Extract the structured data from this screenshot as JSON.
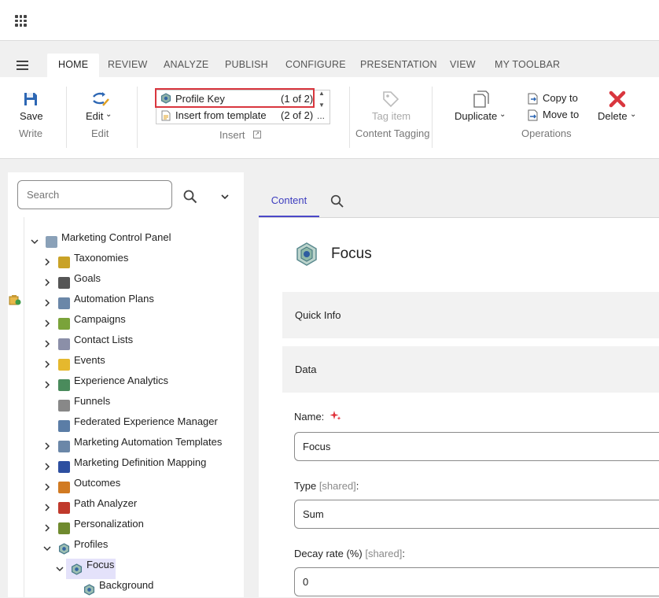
{
  "ribbon_tabs": [
    "HOME",
    "REVIEW",
    "ANALYZE",
    "PUBLISH",
    "CONFIGURE",
    "PRESENTATION",
    "VIEW",
    "MY TOOLBAR"
  ],
  "ribbon": {
    "save": "Save",
    "write": "Write",
    "edit": "Edit",
    "edit_group": "Edit",
    "insert_items": [
      {
        "label": "Profile Key",
        "count": "(1 of 2)"
      },
      {
        "label": "Insert from template",
        "count": "(2 of 2)"
      }
    ],
    "insert_group": "Insert",
    "tag_item": "Tag item",
    "content_tagging": "Content Tagging",
    "duplicate": "Duplicate",
    "copy_to": "Copy to",
    "move_to": "Move to",
    "delete": "Delete",
    "operations": "Operations",
    "more": "..."
  },
  "search": {
    "placeholder": "Search"
  },
  "tree": [
    {
      "label": "Marketing Control Panel",
      "icon": "control-panel-icon"
    },
    {
      "label": "Taxonomies",
      "icon": "books-icon"
    },
    {
      "label": "Goals",
      "icon": "flag-icon"
    },
    {
      "label": "Automation Plans",
      "icon": "automation-icon"
    },
    {
      "label": "Campaigns",
      "icon": "campaign-icon"
    },
    {
      "label": "Contact Lists",
      "icon": "list-icon"
    },
    {
      "label": "Events",
      "icon": "folder-icon"
    },
    {
      "label": "Experience Analytics",
      "icon": "chart-icon"
    },
    {
      "label": "Funnels",
      "icon": "funnel-icon"
    },
    {
      "label": "Federated Experience Manager",
      "icon": "network-icon"
    },
    {
      "label": "Marketing Automation Templates",
      "icon": "automation-icon"
    },
    {
      "label": "Marketing Definition Mapping",
      "icon": "mapping-icon"
    },
    {
      "label": "Outcomes",
      "icon": "outcome-icon"
    },
    {
      "label": "Path Analyzer",
      "icon": "path-icon"
    },
    {
      "label": "Personalization",
      "icon": "grid-icon"
    },
    {
      "label": "Profiles",
      "icon": "profile-icon"
    },
    {
      "label": "Focus",
      "icon": "profile-icon"
    },
    {
      "label": "Background",
      "icon": "profile-icon"
    }
  ],
  "content": {
    "tab_content": "Content",
    "item_title": "Focus",
    "sections": [
      "Quick Info",
      "Data"
    ],
    "fields": [
      {
        "label": "Name:",
        "shared": "",
        "value": "Focus"
      },
      {
        "label": "Type",
        "shared": "[shared]",
        "suffix": ":",
        "value": "Sum"
      },
      {
        "label": "Decay rate (%)",
        "shared": "[shared]",
        "suffix": ":",
        "value": "0"
      }
    ]
  },
  "colors": {
    "accent": "#4b48c8",
    "highlight": "#d9363e",
    "delete": "#d9363e",
    "selected": "#e4e2fa"
  }
}
